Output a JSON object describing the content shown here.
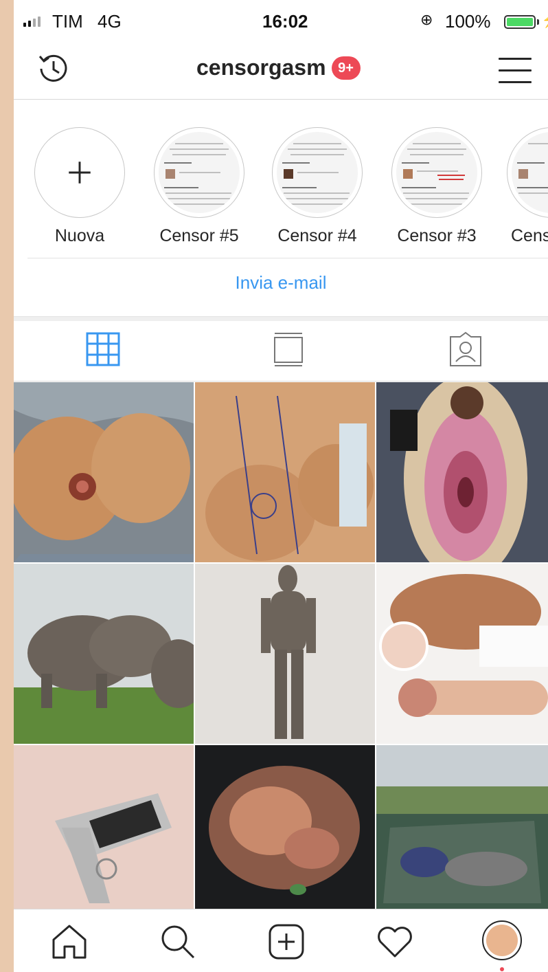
{
  "status_bar": {
    "carrier": "TIM",
    "network": "4G",
    "time": "16:02",
    "battery_percent": "100%",
    "battery_level": 1.0,
    "battery_color": "#4cd964"
  },
  "header": {
    "username": "censorgasm",
    "notification_badge": "9+",
    "history_icon": "history-icon",
    "menu_icon": "hamburger-menu-icon",
    "badge_color": "#ed4956"
  },
  "highlights": [
    {
      "label": "Nuova",
      "type": "new"
    },
    {
      "label": "Censor #5",
      "type": "story"
    },
    {
      "label": "Censor #4",
      "type": "story"
    },
    {
      "label": "Censor #3",
      "type": "story"
    },
    {
      "label": "Cens",
      "type": "story"
    }
  ],
  "email_button": "Invia e-mail",
  "accent_color": "#3897f0",
  "profile_tabs": [
    {
      "name": "grid",
      "icon": "grid-icon",
      "active": true
    },
    {
      "name": "feed",
      "icon": "feed-icon",
      "active": false
    },
    {
      "name": "tagged",
      "icon": "tagged-icon",
      "active": false
    }
  ],
  "posts": [
    {
      "id": 1
    },
    {
      "id": 2
    },
    {
      "id": 3
    },
    {
      "id": 4
    },
    {
      "id": 5
    },
    {
      "id": 6
    },
    {
      "id": 7
    },
    {
      "id": 8
    },
    {
      "id": 9
    }
  ],
  "bottom_nav": [
    {
      "name": "home",
      "icon": "home-icon"
    },
    {
      "name": "search",
      "icon": "search-icon"
    },
    {
      "name": "new-post",
      "icon": "add-post-icon"
    },
    {
      "name": "activity",
      "icon": "heart-icon"
    },
    {
      "name": "profile",
      "icon": "profile-avatar"
    }
  ]
}
